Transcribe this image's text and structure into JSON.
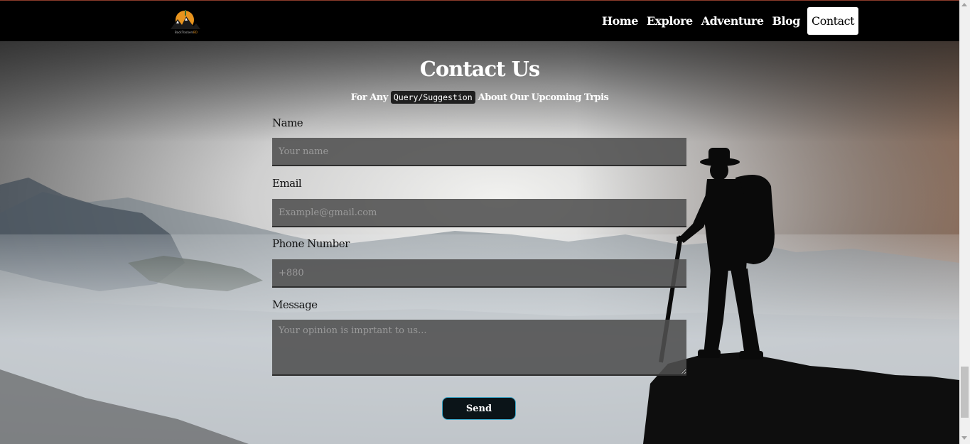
{
  "nav": {
    "logo_alt": "BackTrackersBD",
    "links": [
      {
        "label": "Home"
      },
      {
        "label": "Explore"
      },
      {
        "label": "Adventure"
      },
      {
        "label": "Blog"
      },
      {
        "label": "Contact",
        "active": true
      }
    ]
  },
  "contact": {
    "title": "Contact Us",
    "subtitle_before": "For Any",
    "subtitle_code": "Query/Suggestion",
    "subtitle_after": "About Our Upcoming Trpis",
    "fields": {
      "name": {
        "label": "Name",
        "placeholder": "Your name",
        "value": ""
      },
      "email": {
        "label": "Email",
        "placeholder": "Example@gmail.com",
        "value": ""
      },
      "phone": {
        "label": "Phone Number",
        "placeholder": "+880",
        "value": ""
      },
      "message": {
        "label": "Message",
        "placeholder": "Your opinion is imprtant to us...",
        "value": ""
      }
    },
    "send_label": "Send"
  },
  "colors": {
    "navbar_bg": "#000000",
    "button_border": "#3aa6c8",
    "field_bg": "#505050"
  }
}
